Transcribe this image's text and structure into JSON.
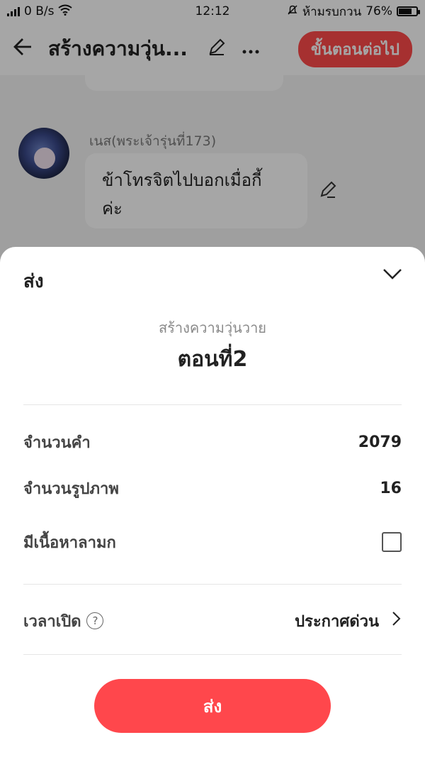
{
  "status_bar": {
    "speed": "0 B/s",
    "time": "12:12",
    "dnd_label": "ห้ามรบกวน",
    "battery_text": "76%",
    "battery_level": 0.76
  },
  "top_bar": {
    "title": "สร้างความวุ่น...",
    "next_label": "ขั้นตอนต่อไป"
  },
  "chat": {
    "sender": "เนส(พระเจ้ารุ่นที่173)",
    "message_line1": "ข้าโทรจิตไปบอกเมื่อกี้",
    "message_line2": "ค่ะ"
  },
  "sheet": {
    "header": "ส่ง",
    "story_title": "สร้างความวุ่นวาย",
    "episode_title": "ตอนที่2",
    "rows": {
      "word_count_label": "จำนวนคำ",
      "word_count_value": "2079",
      "image_count_label": "จำนวนรูปภาพ",
      "image_count_value": "16",
      "adult_label": "มีเนื้อหาลามก",
      "publish_time_label": "เวลาเปิด",
      "publish_time_value": "ประกาศด่วน"
    },
    "send_label": "ส่ง"
  }
}
